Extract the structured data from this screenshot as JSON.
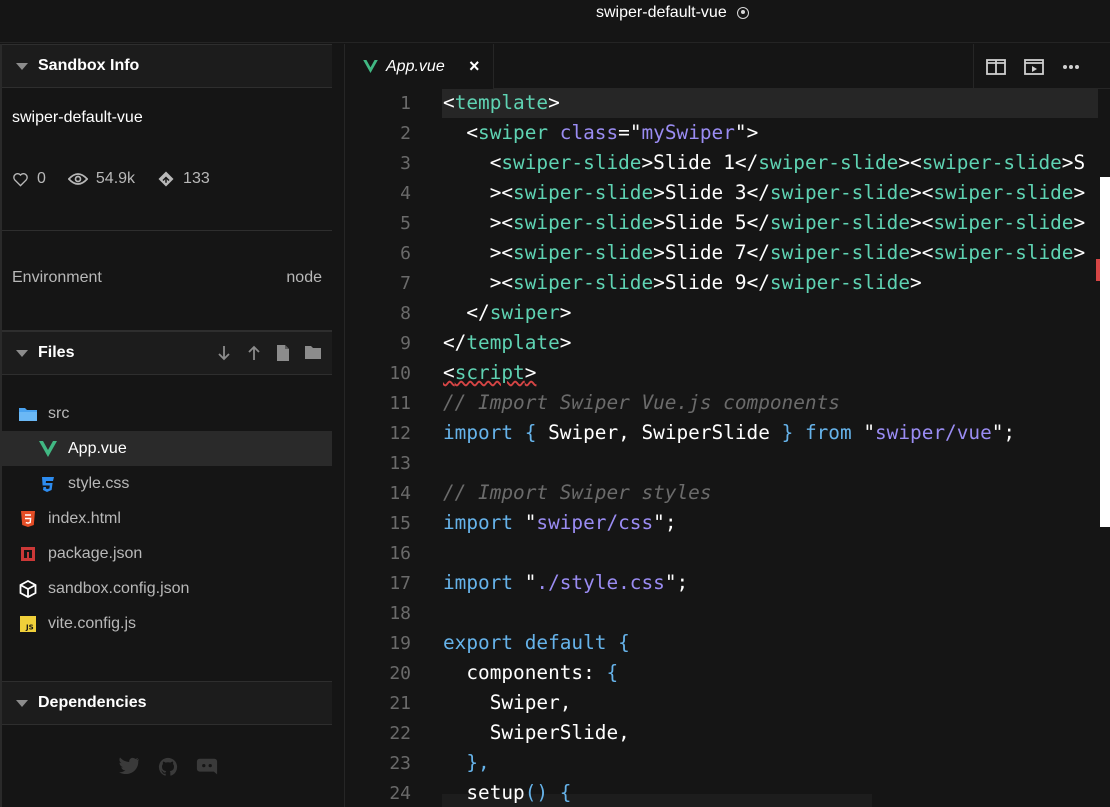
{
  "window": {
    "title": "swiper-default-vue"
  },
  "sidebar": {
    "sandbox_info": {
      "heading": "Sandbox Info",
      "name": "swiper-default-vue",
      "likes": "0",
      "views": "54.9k",
      "forks": "133"
    },
    "environment": {
      "label": "Environment",
      "value": "node"
    },
    "files": {
      "heading": "Files",
      "items": [
        {
          "name": "src",
          "icon": "folder-icon"
        },
        {
          "name": "App.vue",
          "icon": "vue-icon",
          "active": true
        },
        {
          "name": "style.css",
          "icon": "css-icon"
        },
        {
          "name": "index.html",
          "icon": "html-icon"
        },
        {
          "name": "package.json",
          "icon": "npm-icon"
        },
        {
          "name": "sandbox.config.json",
          "icon": "box-icon"
        },
        {
          "name": "vite.config.js",
          "icon": "js-icon"
        }
      ]
    },
    "dependencies": {
      "heading": "Dependencies"
    }
  },
  "editor": {
    "tab": {
      "name": "App.vue",
      "close": "×"
    },
    "line_numbers": [
      "1",
      "2",
      "3",
      "4",
      "5",
      "6",
      "7",
      "8",
      "9",
      "10",
      "11",
      "12",
      "13",
      "14",
      "15",
      "16",
      "17",
      "18",
      "19",
      "20",
      "21",
      "22",
      "23",
      "24"
    ],
    "lines": [
      [
        [
          "t-punc",
          "<"
        ],
        [
          "t-tag",
          "template"
        ],
        [
          "t-punc",
          ">"
        ]
      ],
      [
        [
          "t-punc",
          "  <"
        ],
        [
          "t-tag",
          "swiper"
        ],
        [
          "t-punc",
          " "
        ],
        [
          "t-attr",
          "class"
        ],
        [
          "t-punc",
          "=\""
        ],
        [
          "t-str",
          "mySwiper"
        ],
        [
          "t-punc",
          "\">"
        ]
      ],
      [
        [
          "t-punc",
          "    <"
        ],
        [
          "t-tag",
          "swiper-slide"
        ],
        [
          "t-punc",
          ">"
        ],
        [
          "t-id",
          "Slide 1"
        ],
        [
          "t-punc",
          "</"
        ],
        [
          "t-tag",
          "swiper-slide"
        ],
        [
          "t-punc",
          "><"
        ],
        [
          "t-tag",
          "swiper-slide"
        ],
        [
          "t-punc",
          ">S"
        ]
      ],
      [
        [
          "t-punc",
          "    ><"
        ],
        [
          "t-tag",
          "swiper-slide"
        ],
        [
          "t-punc",
          ">"
        ],
        [
          "t-id",
          "Slide 3"
        ],
        [
          "t-punc",
          "</"
        ],
        [
          "t-tag",
          "swiper-slide"
        ],
        [
          "t-punc",
          "><"
        ],
        [
          "t-tag",
          "swiper-slide"
        ],
        [
          "t-punc",
          ">"
        ]
      ],
      [
        [
          "t-punc",
          "    ><"
        ],
        [
          "t-tag",
          "swiper-slide"
        ],
        [
          "t-punc",
          ">"
        ],
        [
          "t-id",
          "Slide 5"
        ],
        [
          "t-punc",
          "</"
        ],
        [
          "t-tag",
          "swiper-slide"
        ],
        [
          "t-punc",
          "><"
        ],
        [
          "t-tag",
          "swiper-slide"
        ],
        [
          "t-punc",
          ">"
        ]
      ],
      [
        [
          "t-punc",
          "    ><"
        ],
        [
          "t-tag",
          "swiper-slide"
        ],
        [
          "t-punc",
          ">"
        ],
        [
          "t-id",
          "Slide 7"
        ],
        [
          "t-punc",
          "</"
        ],
        [
          "t-tag",
          "swiper-slide"
        ],
        [
          "t-punc",
          "><"
        ],
        [
          "t-tag",
          "swiper-slide"
        ],
        [
          "t-punc",
          ">"
        ]
      ],
      [
        [
          "t-punc",
          "    ><"
        ],
        [
          "t-tag",
          "swiper-slide"
        ],
        [
          "t-punc",
          ">"
        ],
        [
          "t-id",
          "Slide 9"
        ],
        [
          "t-punc",
          "</"
        ],
        [
          "t-tag",
          "swiper-slide"
        ],
        [
          "t-punc",
          ">"
        ]
      ],
      [
        [
          "t-punc",
          "  </"
        ],
        [
          "t-tag",
          "swiper"
        ],
        [
          "t-punc",
          ">"
        ]
      ],
      [
        [
          "t-punc",
          "</"
        ],
        [
          "t-tag",
          "template"
        ],
        [
          "t-punc",
          ">"
        ]
      ],
      [
        [
          "t-punc squiggle",
          "<"
        ],
        [
          "t-tag squiggle",
          "script"
        ],
        [
          "t-punc squiggle",
          ">"
        ]
      ],
      [
        [
          "t-com",
          "// Import Swiper Vue.js components"
        ]
      ],
      [
        [
          "t-kw",
          "import"
        ],
        [
          "t-kw",
          " { "
        ],
        [
          "t-id",
          "Swiper"
        ],
        [
          "t-id",
          ", "
        ],
        [
          "t-id",
          "SwiperSlide"
        ],
        [
          "t-kw",
          " } "
        ],
        [
          "t-kw",
          "from"
        ],
        [
          "t-punc",
          " \""
        ],
        [
          "t-str",
          "swiper/vue"
        ],
        [
          "t-punc",
          "\";"
        ]
      ],
      [],
      [
        [
          "t-com",
          "// Import Swiper styles"
        ]
      ],
      [
        [
          "t-kw",
          "import"
        ],
        [
          "t-punc",
          " \""
        ],
        [
          "t-str",
          "swiper/css"
        ],
        [
          "t-punc",
          "\";"
        ]
      ],
      [],
      [
        [
          "t-kw",
          "import"
        ],
        [
          "t-punc",
          " \""
        ],
        [
          "t-str",
          "./style.css"
        ],
        [
          "t-punc",
          "\";"
        ]
      ],
      [],
      [
        [
          "t-kw",
          "export"
        ],
        [
          "t-kw",
          " default"
        ],
        [
          "t-kw",
          " {"
        ]
      ],
      [
        [
          "t-id",
          "  components"
        ],
        [
          "t-id",
          ": "
        ],
        [
          "t-kw",
          "{"
        ]
      ],
      [
        [
          "t-id",
          "    Swiper,"
        ]
      ],
      [
        [
          "t-id",
          "    SwiperSlide,"
        ]
      ],
      [
        [
          "t-kw",
          "  },"
        ]
      ],
      [
        [
          "t-id",
          "  setup"
        ],
        [
          "t-kw",
          "() {"
        ]
      ]
    ]
  },
  "colors": {
    "tag": "#5fd3b3",
    "attribute": "#9a8cf2",
    "keyword": "#66b3ea",
    "comment": "#6b6b6b",
    "vue_green": "#41b883",
    "css_blue": "#2d8cf0",
    "html_red": "#e44d26",
    "npm_red": "#cb3837",
    "js_yellow": "#f0d03a",
    "folder_blue": "#4aa3f0"
  }
}
